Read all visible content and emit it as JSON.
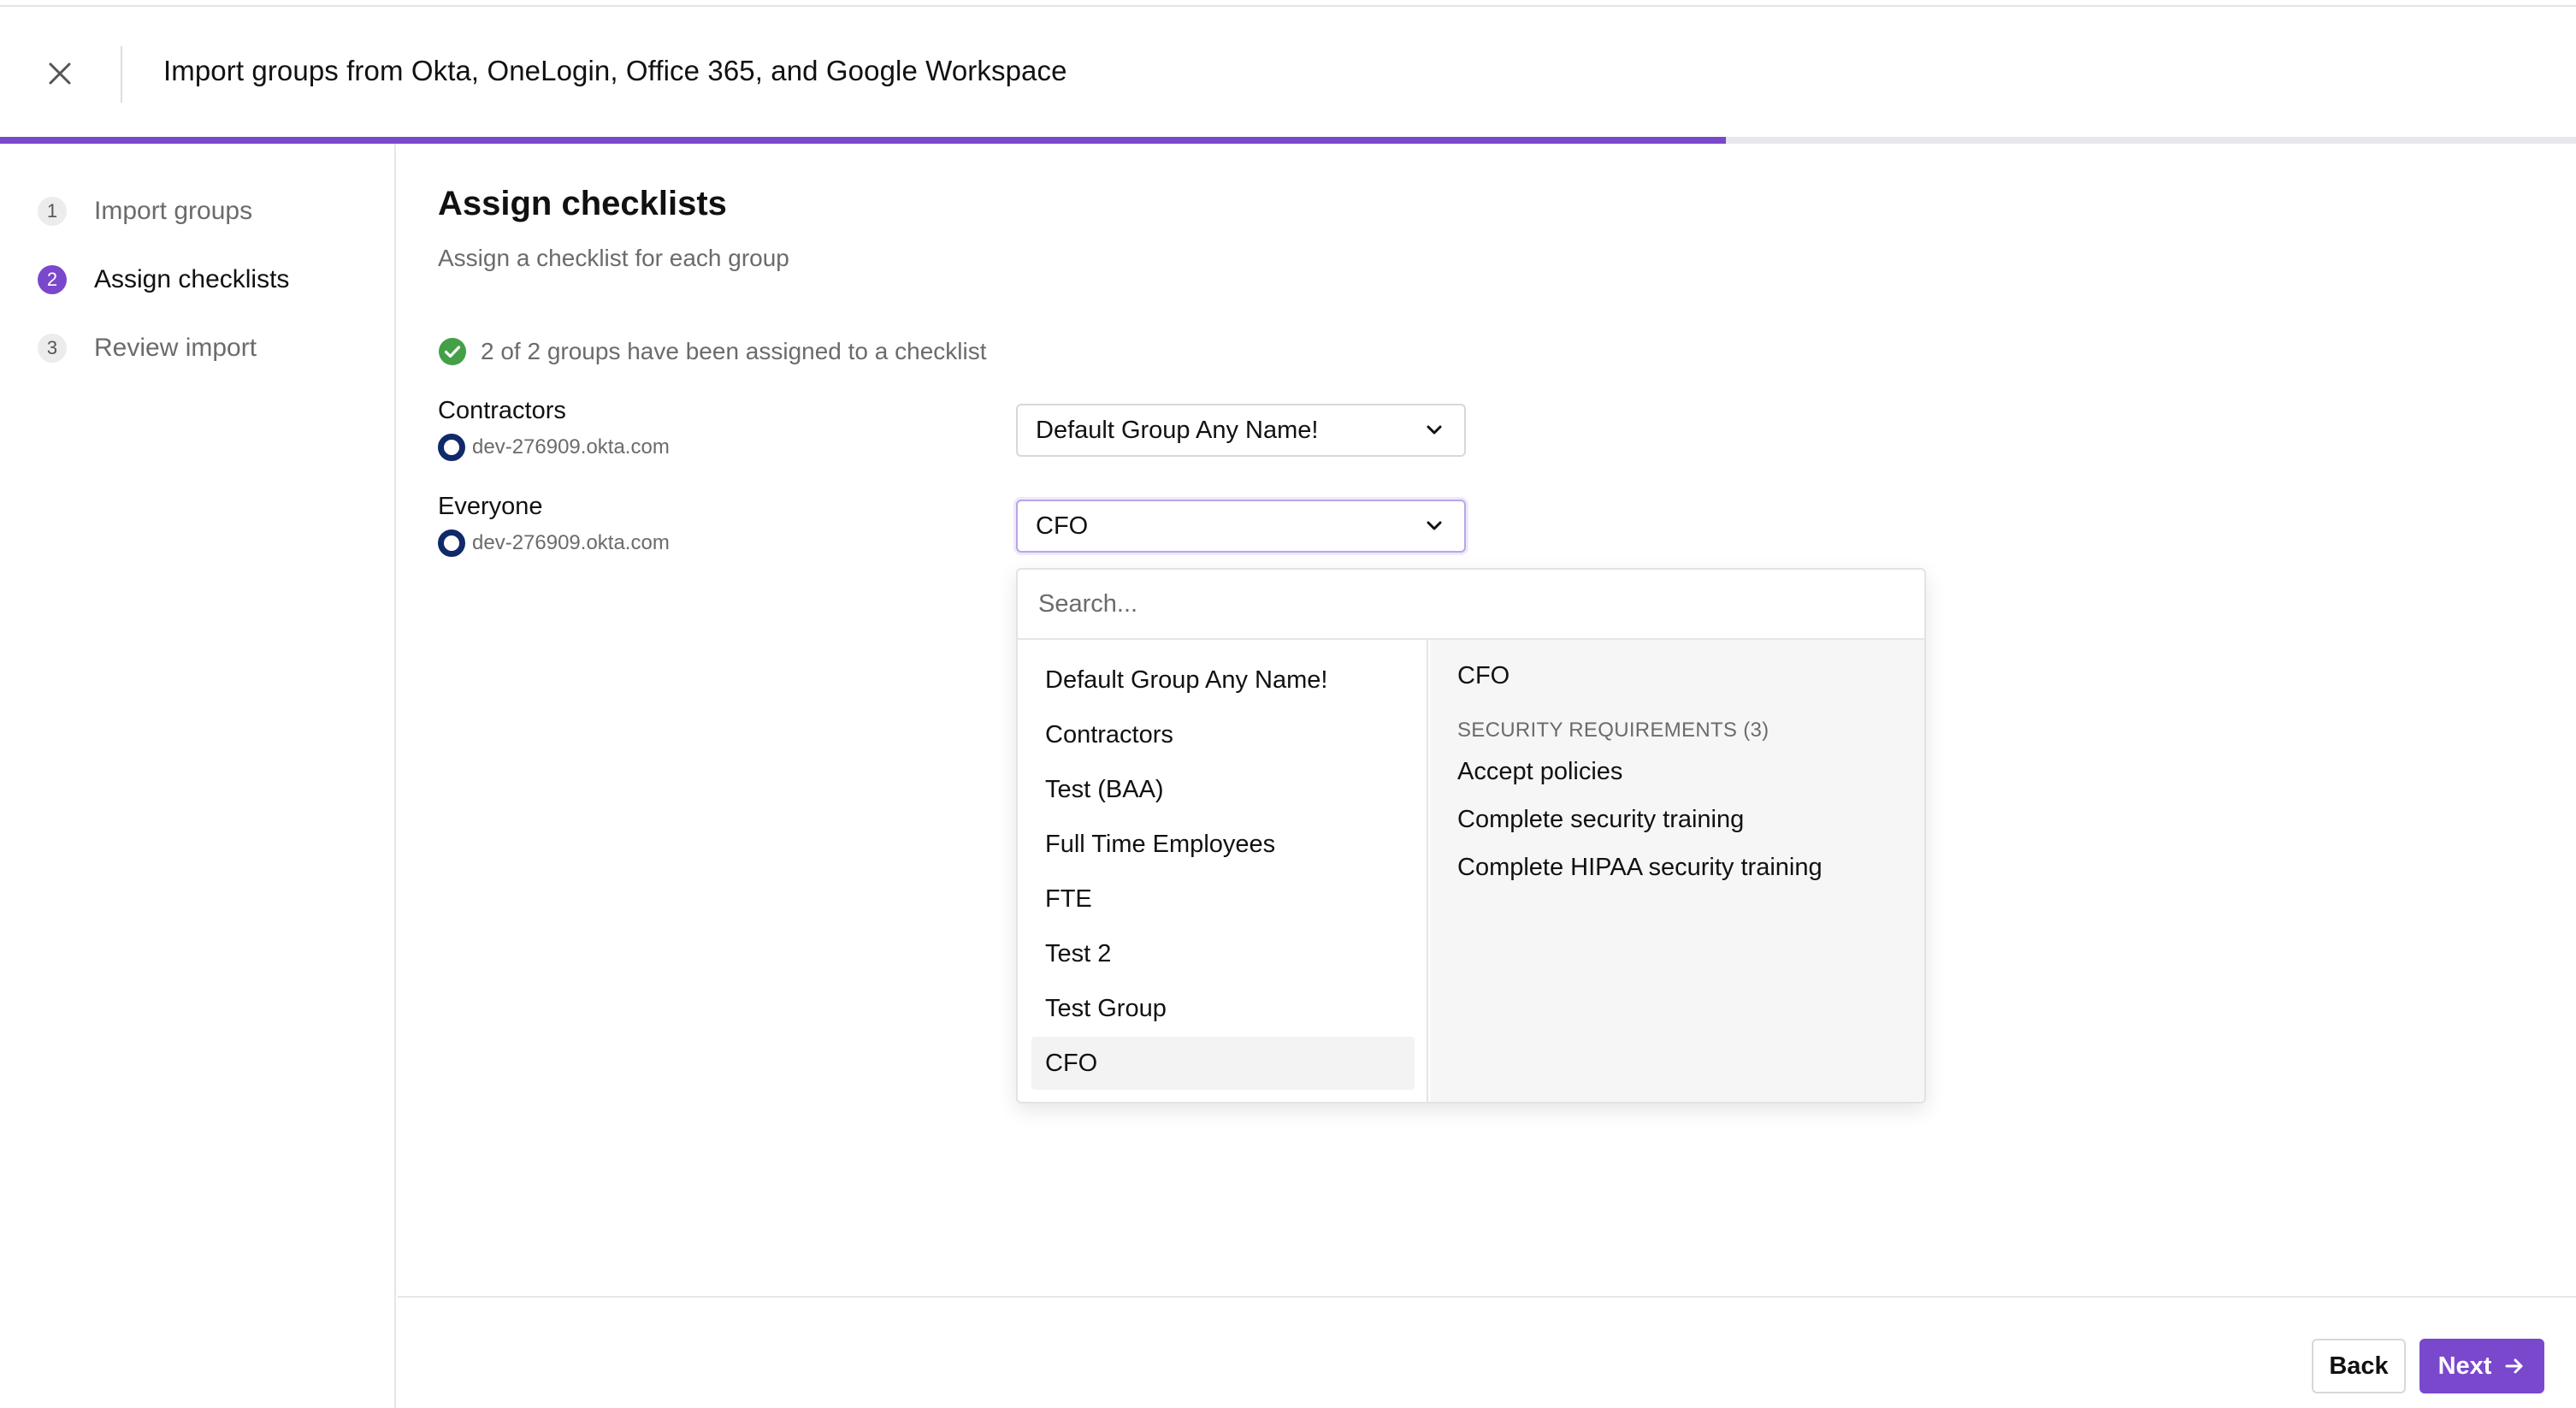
{
  "header": {
    "title": "Import groups from Okta, OneLogin, Office 365, and Google Workspace",
    "close_icon": "close-icon"
  },
  "progress": {
    "fraction": 0.67,
    "color": "#7a48cc"
  },
  "steps": [
    {
      "number": "1",
      "label": "Import groups",
      "active": false
    },
    {
      "number": "2",
      "label": "Assign checklists",
      "active": true
    },
    {
      "number": "3",
      "label": "Review import",
      "active": false
    }
  ],
  "main": {
    "title": "Assign checklists",
    "subtitle": "Assign a checklist for each group",
    "status": {
      "icon": "check-circle-icon",
      "text": "2 of 2 groups have been assigned to a checklist",
      "color": "#43a047"
    },
    "groups": [
      {
        "name": "Contractors",
        "source_icon": "okta-icon",
        "domain": "dev-276909.okta.com",
        "checklist": "Default Group Any Name!"
      },
      {
        "name": "Everyone",
        "source_icon": "okta-icon",
        "domain": "dev-276909.okta.com",
        "checklist": "CFO"
      }
    ]
  },
  "dropdown": {
    "search_placeholder": "Search...",
    "options": [
      "Default Group Any Name!",
      "Contractors",
      "Test (BAA)",
      "Full Time Employees",
      "FTE",
      "Test 2",
      "Test Group",
      "CFO"
    ],
    "selected": "CFO",
    "preview": {
      "title": "CFO",
      "requirements_heading": "SECURITY REQUIREMENTS (3)",
      "requirements": [
        "Accept policies",
        "Complete security training",
        "Complete HIPAA security training"
      ]
    }
  },
  "footer": {
    "back_label": "Back",
    "next_label": "Next",
    "next_icon": "arrow-right-icon"
  },
  "colors": {
    "accent": "#7a48cc",
    "okta": "#10296a",
    "success": "#43a047"
  }
}
